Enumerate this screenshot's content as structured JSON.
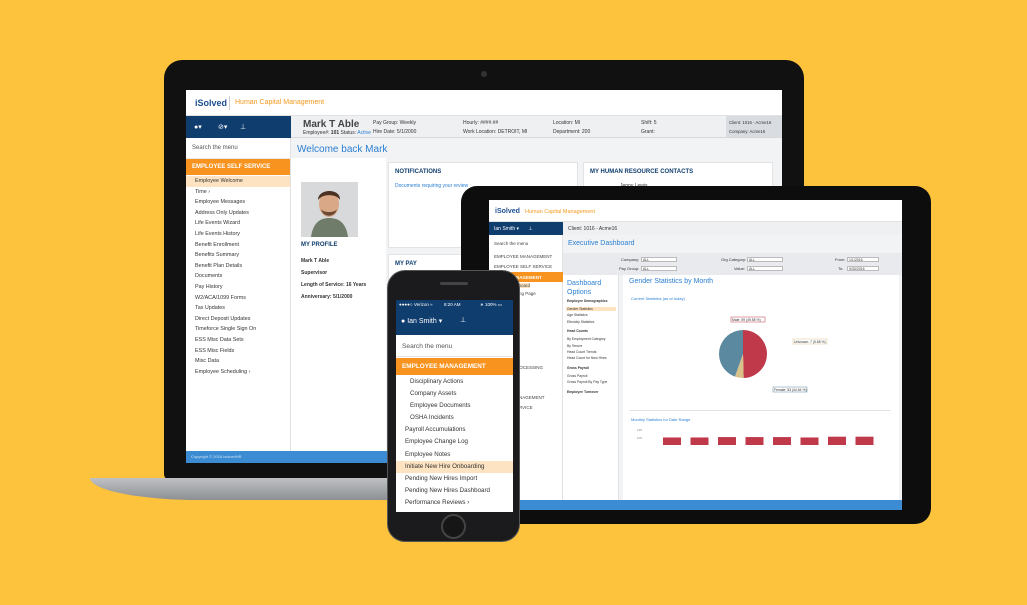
{
  "brand": {
    "logo": "iSolved",
    "product": "Human Capital Management"
  },
  "laptop": {
    "employee": {
      "name": "Mark T Able",
      "employee_label": "Employee#:",
      "employee_num": "101",
      "status_label": "Status:",
      "status": "Active",
      "pay_group": "Pay Group: Weekly",
      "hire_date": "Hire Date: 5/1/2000",
      "hourly": "Hourly: ####.##",
      "work_location": "Work Location: DETROIT, MI",
      "location": "Location: MI",
      "department": "Department: 200",
      "shift": "Shift: 5",
      "grant": "Grant:",
      "client": "Client: 1016 - Acme16",
      "company": "Company: Acme16"
    },
    "search_placeholder": "Search the menu",
    "section": "EMPLOYEE SELF SERVICE",
    "menu": [
      "Employee Welcome",
      "Time ›",
      "Employee Messages",
      "Address Only Updates",
      "Life Events Wizard",
      "Life Events History",
      "Benefit Enrollment",
      "Benefits Summary",
      "Benefit Plan Details",
      "Documents",
      "Pay History",
      "W2/ACA/1099 Forms",
      "Tax Updates",
      "Direct Deposit Updates",
      "Timeforce Single Sign On",
      "ESS Misc Data Sets",
      "ESS Misc Fields",
      "Misc Data",
      "Employee Scheduling ›"
    ],
    "active_item": 0,
    "welcome": "Welcome back Mark",
    "profile": {
      "title": "MY PROFILE",
      "name": "Mark T Able",
      "role": "Supervisor",
      "service": "Length of Service: 16 Years",
      "anniversary": "Anniversary: 5/1/2000"
    },
    "notifications": {
      "title": "NOTIFICATIONS",
      "link": "Documents requiring your review"
    },
    "contacts": {
      "title": "MY HUMAN RESOURCE CONTACTS",
      "name": "Jenny Lewis"
    },
    "mypay": {
      "title": "MY PAY"
    },
    "footer": "Copyright © 2016 isolvedHR"
  },
  "tablet": {
    "nav_user": "Ian Smith ▾",
    "client": "Client: 1016 - Acme16",
    "search_placeholder": "Search the menu",
    "side_items": [
      "EMPLOYEE MANAGEMENT",
      "EMPLOYEE SELF SERVICE"
    ],
    "side_section": "MANAGEMENT",
    "side_sub": [
      "Dashboard",
      "Landing Page",
      "y",
      "ity",
      "ons ›",
      "ts"
    ],
    "page_title": "Executive Dashboard",
    "filters": {
      "company": "Company:",
      "pay_group": "Pay Group:",
      "org_category": "Org Category:",
      "value": "Value:",
      "from": "From:",
      "to": "To:",
      "all": "ALL",
      "from_date": "1/1/2016",
      "to_date": "9/30/2016"
    },
    "options_title": "Dashboard Options",
    "options": [
      {
        "t": "Employee Demographics",
        "b": true
      },
      {
        "t": "Gender Statistics",
        "hl": true
      },
      {
        "t": "Age Statistics"
      },
      {
        "t": "Ethnicity Statistics"
      },
      {
        "t": "Head Counts",
        "b": true
      },
      {
        "t": "By Employment Category"
      },
      {
        "t": "By Tenure"
      },
      {
        "t": "Head Count Trends"
      },
      {
        "t": "Head Count for New Hires"
      },
      {
        "t": "Gross Payroll",
        "b": true
      },
      {
        "t": "Gross Payroll"
      },
      {
        "t": "Gross Payroll By Pay Type"
      },
      {
        "t": "Employee Turnover",
        "b": true
      }
    ],
    "chart_title": "Gender Statistics by Month",
    "current_label": "Current Statistics (as of today)",
    "monthly_label": "Monthly Statistics for Date Range",
    "bottom_items": [
      "ROCESSING",
      "ANAGEMENT",
      "ERVICE"
    ],
    "colors": {
      "male": "#c0394b",
      "female": "#5b8aa0",
      "unknown": "#d9c28a"
    }
  },
  "chart_data": [
    {
      "type": "pie",
      "title": "Current Statistics (as of today)",
      "categories": [
        "Male: 59 (49.58 %)",
        "Unknown: 7 (5.88 %)",
        "Female: 53 (44.54 %)"
      ],
      "values": [
        59,
        7,
        53
      ]
    },
    {
      "type": "bar",
      "title": "Monthly Statistics for Date Range",
      "categories": [
        "1",
        "2",
        "3",
        "4",
        "5",
        "6",
        "7",
        "8"
      ],
      "values": [
        119,
        119,
        120,
        120,
        120,
        119,
        121,
        121
      ],
      "ylabels": [
        "125",
        "100"
      ]
    }
  ],
  "phone": {
    "carrier": "●●●●○ Verizon ≈",
    "time": "8:20 AM",
    "battery": "∗ 100% ▭",
    "user": "Ian Smith ▾",
    "search_placeholder": "Search the menu",
    "section": "EMPLOYEE MANAGEMENT",
    "menu": [
      {
        "t": "Disciplinary Actions",
        "ind": true
      },
      {
        "t": "Company Assets",
        "ind": true
      },
      {
        "t": "Employee Documents",
        "ind": true
      },
      {
        "t": "OSHA Incidents",
        "ind": true
      },
      {
        "t": "Payroll Accumulations"
      },
      {
        "t": "Employee Change Log"
      },
      {
        "t": "Employee Notes"
      },
      {
        "t": "Initiate New Hire Onboarding",
        "active": true
      },
      {
        "t": "Pending New Hires Import"
      },
      {
        "t": "Pending New Hires Dashboard"
      },
      {
        "t": "Performance Reviews ›"
      }
    ]
  }
}
